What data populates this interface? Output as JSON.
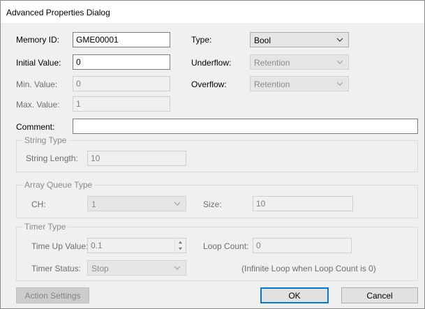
{
  "window": {
    "title": "Advanced Properties Dialog"
  },
  "fields": {
    "memory_id": {
      "label": "Memory ID:",
      "value": "GME00001"
    },
    "initial_value": {
      "label": "Initial Value:",
      "value": "0"
    },
    "min_value": {
      "label": "Min. Value:",
      "value": "0"
    },
    "max_value": {
      "label": "Max. Value:",
      "value": "1"
    },
    "comment": {
      "label": "Comment:",
      "value": ""
    },
    "type": {
      "label": "Type:",
      "value": "Bool"
    },
    "underflow": {
      "label": "Underflow:",
      "value": "Retention"
    },
    "overflow": {
      "label": "Overflow:",
      "value": "Retention"
    }
  },
  "string_type": {
    "title": "String Type",
    "length_label": "String Length:",
    "length_value": "10"
  },
  "array_queue": {
    "title": "Array Queue Type",
    "ch_label": "CH:",
    "ch_value": "1",
    "size_label": "Size:",
    "size_value": "10"
  },
  "timer": {
    "title": "Timer Type",
    "time_up_label": "Time Up Value:",
    "time_up_value": "0.1",
    "loop_count_label": "Loop Count:",
    "loop_count_value": "0",
    "status_label": "Timer Status:",
    "status_value": "Stop",
    "note": "(Infinite Loop when Loop Count is 0)"
  },
  "buttons": {
    "action_settings": "Action Settings",
    "ok": "OK",
    "cancel": "Cancel"
  },
  "icons": {
    "dropdown": "chevron-down-icon",
    "spin_up": "arrow-up-icon",
    "spin_down": "arrow-down-icon"
  },
  "colors": {
    "focus_border": "#0078d7",
    "dialog_bg": "#f0f0f0"
  }
}
